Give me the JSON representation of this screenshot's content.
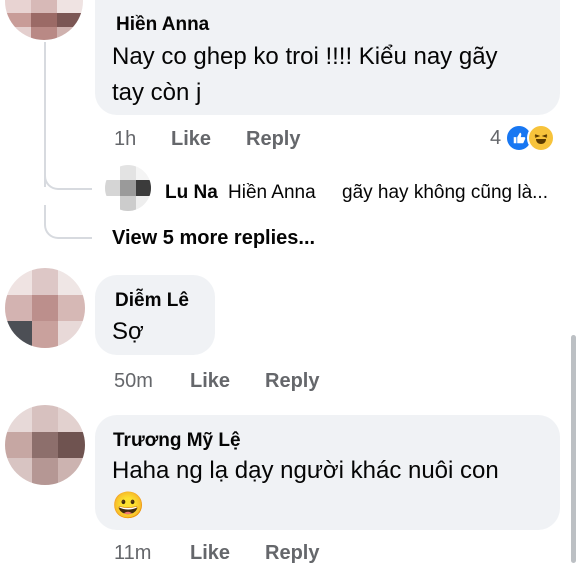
{
  "comments": [
    {
      "name": "Hiền Anna",
      "text_line1": "Nay co ghep ko troi !!!! Kiểu nay gãy",
      "text_line2": "tay còn j",
      "time": "1h",
      "like": "Like",
      "reply": "Reply",
      "reaction_count": "4",
      "reaction_icons": [
        "like-icon",
        "haha-icon"
      ],
      "avatar_colors": [
        "#e8d3d2",
        "#d7b9b7",
        "#efe3e2",
        "#c89c98",
        "#9b6a66",
        "#7b5654",
        "#e4cfce",
        "#b98985",
        "#cfb1ae"
      ]
    },
    {
      "name": "Diễm Lê",
      "text_line1": "Sợ",
      "time": "50m",
      "like": "Like",
      "reply": "Reply",
      "avatar_colors": [
        "#efe3e2",
        "#ddc7c6",
        "#efe6e5",
        "#d3b3b1",
        "#bc8f8c",
        "#d6b8b5",
        "#4c4f55",
        "#c9a19d",
        "#e8d9d8"
      ]
    },
    {
      "name": "Trương Mỹ Lệ",
      "text_line1": "Haha ng lạ dạy người khác nuôi con",
      "emoji": "😀",
      "time": "11m",
      "like": "Like",
      "reply": "Reply",
      "avatar_colors": [
        "#e7d9d8",
        "#d7c1bf",
        "#e2d1cf",
        "#c6a7a3",
        "#8d6f6c",
        "#6f5350",
        "#d8c4c2",
        "#b59794",
        "#ccb3b0"
      ]
    }
  ],
  "nested_reply": {
    "name": "Lu Na",
    "mention": "Hiền Anna",
    "text": "gãy hay không cũng là...",
    "avatar_colors": [
      "#ffffff",
      "#e3e3e3",
      "#f4f4f4",
      "#d5d5d5",
      "#9a9a9a",
      "#3b3b3b",
      "#ffffff",
      "#cccccc",
      "#eeeeee"
    ]
  },
  "view_more": "View 5 more replies..."
}
